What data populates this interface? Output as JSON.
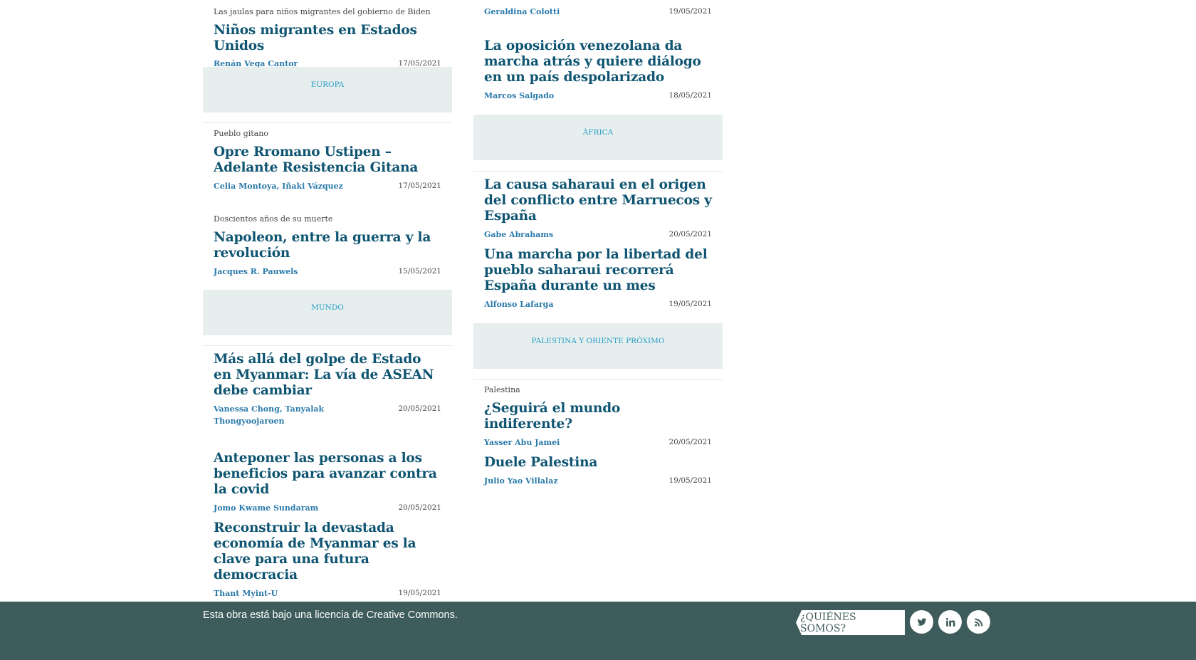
{
  "left_column": {
    "a1": {
      "kicker": "Las jaulas para niños migrantes del gobierno de Biden",
      "title": "Niños migrantes en Estados Unidos",
      "author": "Renán Vega Cantor",
      "date": "17/05/2021"
    },
    "section1": "EUROPA",
    "a2": {
      "kicker": "Pueblo gitano",
      "title": "Opre Rromano Ustipen – Adelante Resistencia Gitana",
      "author": "Celia Montoya, Iñaki Vázquez",
      "date": "17/05/2021"
    },
    "a3": {
      "kicker": "Doscientos años de su muerte",
      "title": "Napoleon, entre la guerra y la revolución",
      "author": "Jacques R. Pauwels",
      "date": "15/05/2021"
    },
    "section2": "MUNDO",
    "a4": {
      "title": "Más allá del golpe de Estado en Myanmar: La vía de ASEAN debe cambiar",
      "author": "Vanessa Chong, Tanyalak Thongyoojaroen",
      "date": "20/05/2021"
    },
    "a5": {
      "title": "Anteponer las personas a los beneficios para avanzar contra la covid",
      "author": "Jomo Kwame Sundaram",
      "date": "20/05/2021"
    },
    "a6": {
      "title": "Reconstruir la devastada economía de Myanmar es la clave para una futura democracia",
      "author": "Thant Myint-U",
      "date": "19/05/2021"
    }
  },
  "right_column": {
    "b0": {
      "author": "Geraldina Colotti",
      "date": "19/05/2021"
    },
    "b1": {
      "title": "La oposición venezolana da marcha atrás y quiere diálogo en un país despolarizado",
      "author": "Marcos Salgado",
      "date": "18/05/2021"
    },
    "section1": "ÁFRICA",
    "b2": {
      "title": "La causa saharaui en el origen del conflicto entre Marruecos y España",
      "author": "Gabe Abrahams",
      "date": "20/05/2021"
    },
    "b3": {
      "title": "Una marcha por la libertad del pueblo saharaui recorrerá España durante un mes",
      "author": "Alfonso Lafarga",
      "date": "19/05/2021"
    },
    "section2": "PALESTINA Y ORIENTE PRÓXIMO",
    "b4": {
      "kicker": "Palestina",
      "title": "¿Seguirá el mundo indiferente?",
      "author": "Yasser Abu Jamei",
      "date": "20/05/2021"
    },
    "b5": {
      "title": "Duele Palestina",
      "author": "Julio Yao Villalaz",
      "date": "19/05/2021"
    }
  },
  "footer": {
    "license_text": "Esta obra está bajo una licencia de Creative Commons.",
    "about_label": "¿QUIÉNES SOMOS?",
    "icons": [
      "twitter-icon",
      "linkedin-icon",
      "rss-icon"
    ]
  },
  "colors": {
    "title": "#0f5572",
    "author": "#2a7aab",
    "section_band": "#e6efee",
    "section_label": "#2a9bc6",
    "footer": "#3e5c5b"
  }
}
